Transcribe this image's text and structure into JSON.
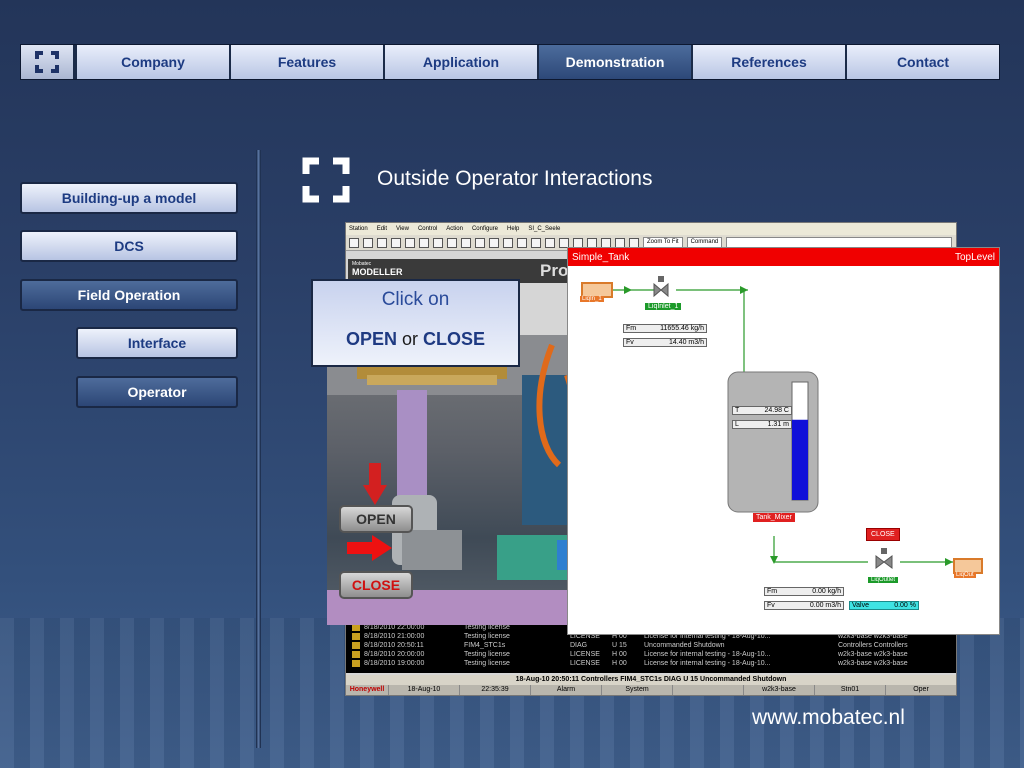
{
  "nav": {
    "items": [
      "Company",
      "Features",
      "Application",
      "Demonstration",
      "References",
      "Contact"
    ],
    "active": "Demonstration"
  },
  "sidebar": {
    "items": [
      "Building-up a model",
      "DCS",
      "Field Operation",
      "Interface",
      "Operator"
    ]
  },
  "page": {
    "title": "Outside Operator Interactions",
    "url": "www.mobatec.nl"
  },
  "callout": {
    "line1": "Click on",
    "open": "OPEN",
    "or": " or ",
    "close": "CLOSE"
  },
  "screenshot": {
    "menu": [
      "Station",
      "Edit",
      "View",
      "Control",
      "Action",
      "Configure",
      "Help",
      "SI_C_Seele"
    ],
    "zoom": "Zoom To Fit",
    "command": "Command",
    "app_label": "MODELLER",
    "app_brand": "Mobatec",
    "partial_title": "Pro",
    "events": [
      [
        "8/18/2010 22:00:00",
        "Testing license",
        "",
        "",
        "",
        ""
      ],
      [
        "8/18/2010 21:00:00",
        "Testing license",
        "LICENSE",
        "H 00",
        "License for internal testing - 18-Aug-10...",
        "w2k3-base  w2k3-base"
      ],
      [
        "8/18/2010 20:50:11",
        "FIM4_STC1s",
        "DIAG",
        "U 15",
        "Uncommanded Shutdown",
        "Controllers  Controllers"
      ],
      [
        "8/18/2010 20:00:00",
        "Testing license",
        "LICENSE",
        "H 00",
        "License for internal testing - 18-Aug-10...",
        "w2k3-base  w2k3-base"
      ],
      [
        "8/18/2010 19:00:00",
        "Testing license",
        "LICENSE",
        "H 00",
        "License for internal testing - 18-Aug-10...",
        "w2k3-base  w2k3-base"
      ]
    ],
    "status_line": "18-Aug-10  20:50:11  Controllers  FIM4_STC1s  DIAG  U 15 Uncommanded Shutdown",
    "status_bar": [
      "Honeywell",
      "18-Aug-10",
      "22:35:39",
      "Alarm",
      "System",
      "",
      "w2k3-base",
      "Stn01",
      "Oper"
    ]
  },
  "photo": {
    "open_label": "OPEN",
    "close_label": "CLOSE"
  },
  "tank_window": {
    "title": "Simple_Tank",
    "right": "TopLevel",
    "liqin": "LiqIn_1",
    "liqinlet": "LiqInlet_1",
    "fm_label": "Fm",
    "fm_value": "11655.46 kg/h",
    "fv_label": "Fv",
    "fv_value": "14.40 m3/h",
    "t_label": "T",
    "t_value": "24.98 C",
    "l_label": "L",
    "l_value": "1.31 m",
    "tank_name": "Tank_Mixer",
    "close_btn": "CLOSE",
    "liqoutlet": "LiqOutlet",
    "liqout": "LiqOut",
    "fm2_value": "0.00 kg/h",
    "fv2_value": "0.00 m3/h",
    "valve_label": "Valve",
    "valve_value": "0.00 %",
    "tank_level": 0.68
  }
}
